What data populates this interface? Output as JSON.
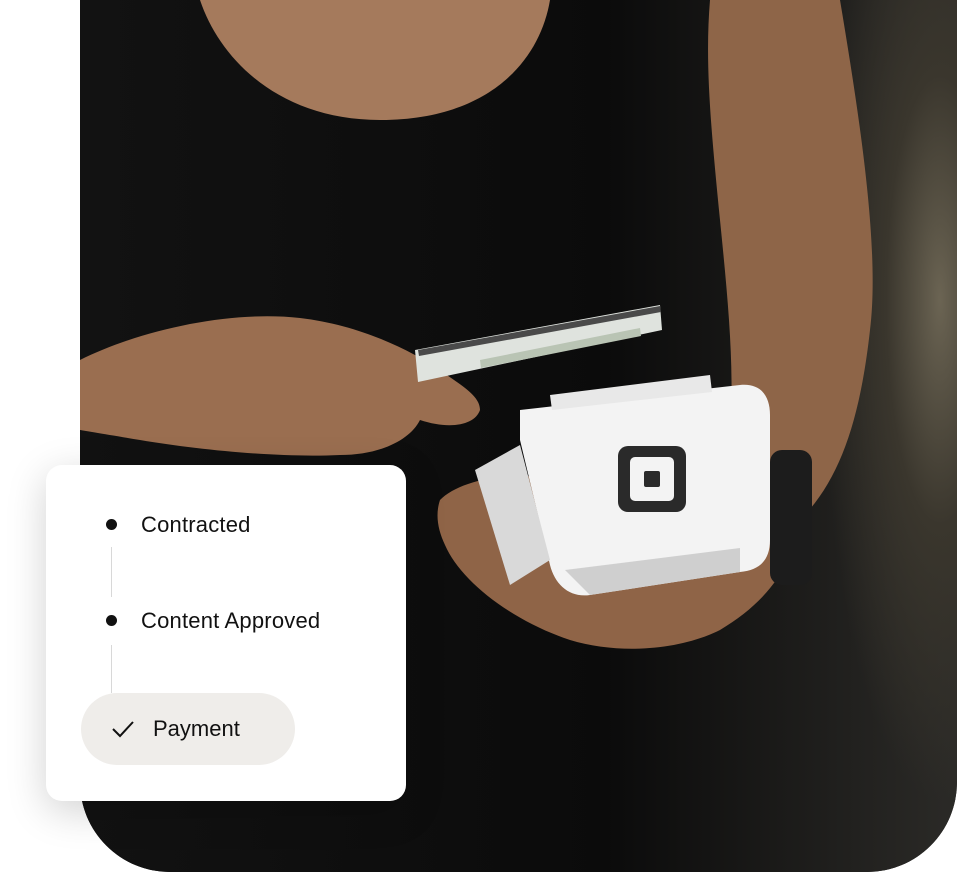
{
  "status_card": {
    "steps": [
      {
        "label": "Contracted",
        "state": "done"
      },
      {
        "label": "Content Approved",
        "state": "done"
      },
      {
        "label": "Payment",
        "state": "current"
      }
    ]
  },
  "photo": {
    "reader_icon": "square-logo-icon"
  },
  "colors": {
    "card_background": "#ffffff",
    "pill_background": "#efedea",
    "text": "#111111"
  }
}
